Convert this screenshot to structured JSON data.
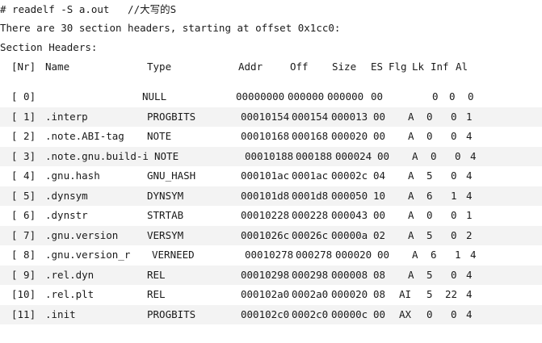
{
  "terminal": {
    "command": "# readelf -S a.out   //大写的S",
    "summary": "There are 30 section headers, starting at offset 0x1cc0:",
    "section_label": "Section Headers:",
    "columns": [
      "[Nr]",
      "Name",
      "Type",
      "Addr",
      "Off",
      "Size",
      "ES",
      "Flg",
      "Lk",
      "Inf",
      "Al"
    ],
    "rows": [
      {
        "nr": "[ 0]",
        "name": "",
        "type": "NULL",
        "addr": "00000000",
        "off": "000000",
        "size": "000000",
        "es": "00",
        "flg": "",
        "lk": "0",
        "inf": "0",
        "al": "0"
      },
      {
        "nr": "[ 1]",
        "name": ".interp",
        "type": "PROGBITS",
        "addr": "00010154",
        "off": "000154",
        "size": "000013",
        "es": "00",
        "flg": "A",
        "lk": "0",
        "inf": "0",
        "al": "1"
      },
      {
        "nr": "[ 2]",
        "name": ".note.ABI-tag",
        "type": "NOTE",
        "addr": "00010168",
        "off": "000168",
        "size": "000020",
        "es": "00",
        "flg": "A",
        "lk": "0",
        "inf": "0",
        "al": "4"
      },
      {
        "nr": "[ 3]",
        "name": ".note.gnu.build-i",
        "type": "NOTE",
        "addr": "00010188",
        "off": "000188",
        "size": "000024",
        "es": "00",
        "flg": "A",
        "lk": "0",
        "inf": "0",
        "al": "4"
      },
      {
        "nr": "[ 4]",
        "name": ".gnu.hash",
        "type": "GNU_HASH",
        "addr": "000101ac",
        "off": "0001ac",
        "size": "00002c",
        "es": "04",
        "flg": "A",
        "lk": "5",
        "inf": "0",
        "al": "4"
      },
      {
        "nr": "[ 5]",
        "name": ".dynsym",
        "type": "DYNSYM",
        "addr": "000101d8",
        "off": "0001d8",
        "size": "000050",
        "es": "10",
        "flg": "A",
        "lk": "6",
        "inf": "1",
        "al": "4"
      },
      {
        "nr": "[ 6]",
        "name": ".dynstr",
        "type": "STRTAB",
        "addr": "00010228",
        "off": "000228",
        "size": "000043",
        "es": "00",
        "flg": "A",
        "lk": "0",
        "inf": "0",
        "al": "1"
      },
      {
        "nr": "[ 7]",
        "name": ".gnu.version",
        "type": "VERSYM",
        "addr": "0001026c",
        "off": "00026c",
        "size": "00000a",
        "es": "02",
        "flg": "A",
        "lk": "5",
        "inf": "0",
        "al": "2"
      },
      {
        "nr": "[ 8]",
        "name": ".gnu.version_r",
        "type": "VERNEED",
        "addr": "00010278",
        "off": "000278",
        "size": "000020",
        "es": "00",
        "flg": "A",
        "lk": "6",
        "inf": "1",
        "al": "4"
      },
      {
        "nr": "[ 9]",
        "name": ".rel.dyn",
        "type": "REL",
        "addr": "00010298",
        "off": "000298",
        "size": "000008",
        "es": "08",
        "flg": "A",
        "lk": "5",
        "inf": "0",
        "al": "4"
      },
      {
        "nr": "[10]",
        "name": ".rel.plt",
        "type": "REL",
        "addr": "000102a0",
        "off": "0002a0",
        "size": "000020",
        "es": "08",
        "flg": "AI",
        "lk": "5",
        "inf": "22",
        "al": "4"
      },
      {
        "nr": "[11]",
        "name": ".init",
        "type": "PROGBITS",
        "addr": "000102c0",
        "off": "0002c0",
        "size": "00000c",
        "es": "00",
        "flg": "AX",
        "lk": "0",
        "inf": "0",
        "al": "4"
      }
    ]
  },
  "colors": {
    "background": "#ffffff",
    "text": "#1a1a1a",
    "alt_row": "#f3f3f3"
  }
}
